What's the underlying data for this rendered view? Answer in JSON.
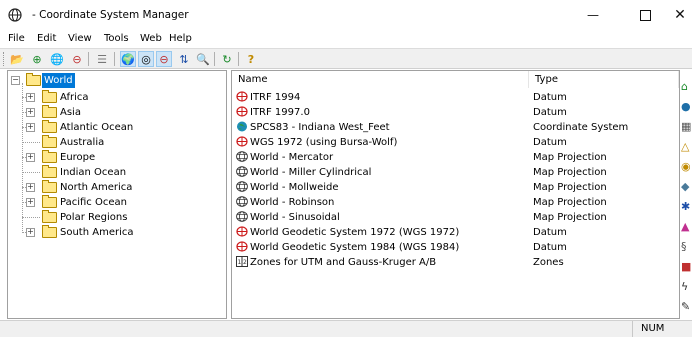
{
  "window": {
    "title": "- Coordinate System Manager",
    "minimize_glyph": "—",
    "close_glyph": "✕"
  },
  "menu": [
    "File",
    "Edit",
    "View",
    "Tools",
    "Web",
    "Help"
  ],
  "toolbar": {
    "buttons": [
      {
        "icon": "open-folder-icon",
        "glyph": "📂"
      },
      {
        "icon": "add-green-globe-icon",
        "glyph": "⊕"
      },
      {
        "icon": "add-map-projection-icon",
        "glyph": "🌐"
      },
      {
        "icon": "delete-icon",
        "glyph": "⊖"
      },
      {
        "icon": "properties-icon",
        "glyph": "☰"
      },
      {
        "icon": "geographic-view-icon",
        "glyph": "🌍"
      },
      {
        "icon": "projected-view-icon",
        "glyph": "◎"
      },
      {
        "icon": "datum-view-icon",
        "glyph": "⊖"
      },
      {
        "icon": "sort-icon",
        "glyph": "⇅"
      },
      {
        "icon": "find-icon",
        "glyph": "🔍"
      },
      {
        "icon": "refresh-icon",
        "glyph": "↻"
      },
      {
        "icon": "help-icon",
        "glyph": "?"
      }
    ]
  },
  "tree": {
    "root": "World",
    "items": [
      "Africa",
      "Asia",
      "Atlantic Ocean",
      "Australia",
      "Europe",
      "Indian Ocean",
      "North America",
      "Pacific Ocean",
      "Polar Regions",
      "South America"
    ]
  },
  "list": {
    "columns": [
      "Name",
      "Type"
    ],
    "rows": [
      {
        "name": "ITRF 1994",
        "type": "Datum",
        "icon": "datum-icon"
      },
      {
        "name": "ITRF 1997.0",
        "type": "Datum",
        "icon": "datum-icon"
      },
      {
        "name": "SPCS83 - Indiana West_Feet",
        "type": "Coordinate System",
        "icon": "coordinate-system-globe-icon"
      },
      {
        "name": "WGS 1972 (using Bursa-Wolf)",
        "type": "Datum",
        "icon": "datum-icon"
      },
      {
        "name": "World - Mercator",
        "type": "Map Projection",
        "icon": "map-projection-icon"
      },
      {
        "name": "World - Miller Cylindrical",
        "type": "Map Projection",
        "icon": "map-projection-icon"
      },
      {
        "name": "World - Mollweide",
        "type": "Map Projection",
        "icon": "map-projection-icon"
      },
      {
        "name": "World - Robinson",
        "type": "Map Projection",
        "icon": "map-projection-icon"
      },
      {
        "name": "World - Sinusoidal",
        "type": "Map Projection",
        "icon": "map-projection-icon"
      },
      {
        "name": "World Geodetic System 1972 (WGS 1972)",
        "type": "Datum",
        "icon": "datum-icon"
      },
      {
        "name": "World Geodetic System 1984 (WGS 1984)",
        "type": "Datum",
        "icon": "datum-icon"
      },
      {
        "name": "Zones for UTM and Gauss-Kruger A/B",
        "type": "Zones",
        "icon": "zones-icon"
      }
    ]
  },
  "status": {
    "num": "NUM"
  },
  "colors": {
    "selection": "#0078d7",
    "folder": "#ffe88a",
    "datum_red": "#cc1a1a",
    "globe_teal": "#1e8fb5"
  }
}
